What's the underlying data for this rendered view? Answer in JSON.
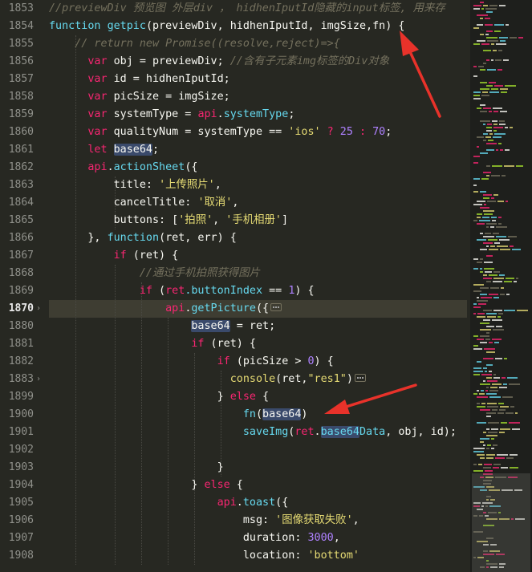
{
  "editor": {
    "theme_colors": {
      "background": "#272822",
      "keyword": "#f92672",
      "function": "#66d9ef",
      "string": "#e6db74",
      "number": "#ae81ff",
      "comment": "#75715e",
      "annotation_arrow": "#e8322a"
    },
    "active_line": "1870",
    "gutter": {
      "line_numbers": [
        "1853",
        "1854",
        "1855",
        "1856",
        "1857",
        "1858",
        "1859",
        "1860",
        "1861",
        "1862",
        "1863",
        "1864",
        "1865",
        "1866",
        "1867",
        "1868",
        "1869",
        "1870",
        "1880",
        "1881",
        "1882",
        "1883",
        "1899",
        "1900",
        "1901",
        "1902",
        "1903",
        "1904",
        "1905",
        "1906",
        "1907",
        "1908"
      ]
    },
    "code": {
      "l1853_comment": "//previewDiv 预览图 外层div ， hidhenIputId隐藏的input标签, 用来存",
      "l1854_kw": "function",
      "l1854_fn": "getpic",
      "l1854_args": "(previewDiv, hidhenIputId, imgSize,fn) {",
      "l1855_comment": "// return new Promise((resolve,reject)=>{",
      "l1856_kw": "var",
      "l1856_txt": " obj = previewDiv; ",
      "l1856_comment": "//含有子元素img标签的Div对象",
      "l1857_kw": "var",
      "l1857_txt": " id = hidhenIputId;",
      "l1858_kw": "var",
      "l1858_txt": " picSize = imgSize;",
      "l1859_kw": "var",
      "l1859_txt": " systemType = ",
      "l1859_obj": "api",
      "l1859_dot": ".",
      "l1859_prop": "systemType",
      "l1859_end": ";",
      "l1860_kw": "var",
      "l1860_txt": " qualityNum = systemType == ",
      "l1860_str": "'ios'",
      "l1860_q": " ? ",
      "l1860_n1": "25",
      "l1860_c": " : ",
      "l1860_n2": "70",
      "l1860_end": ";",
      "l1861_kw": "let",
      "l1861_var": "base64",
      "l1861_end": ";",
      "l1862_obj": "api",
      "l1862_dot": ".",
      "l1862_fn": "actionSheet",
      "l1862_end": "({",
      "l1863_key": "title: ",
      "l1863_str": "'上传照片'",
      "l1863_end": ",",
      "l1864_key": "cancelTitle: ",
      "l1864_str": "'取消'",
      "l1864_end": ",",
      "l1865_key": "buttons: [",
      "l1865_str1": "'拍照'",
      "l1865_sep": ", ",
      "l1865_str2": "'手机相册'",
      "l1865_end": "]",
      "l1866_pre": "}, ",
      "l1866_kw": "function",
      "l1866_txt": "(ret, err) {",
      "l1867_kw": "if",
      "l1867_txt": " (ret) {",
      "l1868_comment": "//通过手机拍照获得图片",
      "l1869_kw": "if",
      "l1869_txt1": " (",
      "l1869_obj": "ret",
      "l1869_prop": ".buttonIndex",
      "l1869_txt2": " == ",
      "l1869_num": "1",
      "l1869_end": ") {",
      "l1870_obj": "api",
      "l1870_dot": ".",
      "l1870_fn": "getPicture",
      "l1870_end": "({",
      "l1880_var": "base64",
      "l1880_txt": " = ret;",
      "l1881_kw": "if",
      "l1881_txt": " (ret) {",
      "l1882_kw": "if",
      "l1882_txt1": " (picSize > ",
      "l1882_num": "0",
      "l1882_txt2": ") {",
      "l1883_fn": "console",
      "l1883_txt1": "(ret,",
      "l1883_str": "\"res1\"",
      "l1883_txt2": ")",
      "l1899_pre": "} ",
      "l1899_kw": "else",
      "l1899_end": " {",
      "l1900_fn": "fn",
      "l1900_open": "(",
      "l1900_var": "base64",
      "l1900_close": ")",
      "l1901_fn": "saveImg",
      "l1901_open": "(",
      "l1901_obj": "ret",
      "l1901_dot": ".",
      "l1901_var": "base64",
      "l1901_rest": "Data",
      "l1901_end": ", obj, id);",
      "l1903_txt": "}",
      "l1904_pre": "} ",
      "l1904_kw": "else",
      "l1904_end": " {",
      "l1905_obj": "api",
      "l1905_dot": ".",
      "l1905_fn": "toast",
      "l1905_end": "({",
      "l1906_key": "msg: ",
      "l1906_str": "'图像获取失败'",
      "l1906_end": ",",
      "l1907_key": "duration: ",
      "l1907_num": "3000",
      "l1907_end": ",",
      "l1908_key": "location: ",
      "l1908_str": "'bottom'"
    },
    "icons": {
      "fold_marker": "chevron-right-icon",
      "folded_block": "ellipsis-fold-icon",
      "annotation": "red-arrow-icon"
    }
  }
}
